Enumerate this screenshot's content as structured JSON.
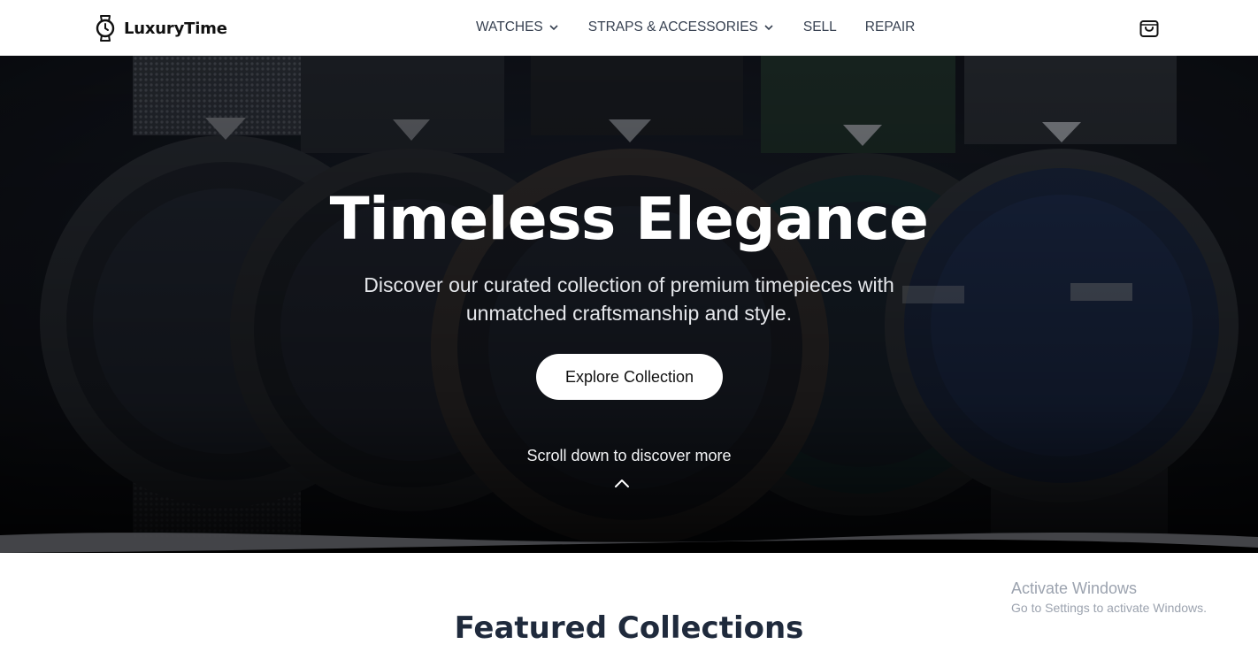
{
  "brand": {
    "name": "LuxuryTime",
    "icon": "watch-icon"
  },
  "nav": {
    "items": [
      {
        "label": "WATCHES",
        "has_dropdown": true
      },
      {
        "label": "STRAPS & ACCESSORIES",
        "has_dropdown": true
      },
      {
        "label": "SELL",
        "has_dropdown": false
      },
      {
        "label": "REPAIR",
        "has_dropdown": false
      }
    ],
    "cart_icon": "shopping-bag-icon"
  },
  "hero": {
    "title": "Timeless Elegance",
    "subtitle": "Discover our curated collection of premium timepieces with unmatched craftsmanship and style.",
    "cta_label": "Explore Collection",
    "scroll_text": "Scroll down to discover more",
    "scroll_icon": "chevron-up-icon"
  },
  "featured": {
    "title": "Featured Collections"
  },
  "os_overlay": {
    "title": "Activate Windows",
    "subtitle": "Go to Settings to activate Windows."
  },
  "colors": {
    "hero_overlay": "#0b0d12",
    "text_dark": "#1f2a3c",
    "nav_text": "#374151",
    "button_bg": "#ffffff"
  }
}
